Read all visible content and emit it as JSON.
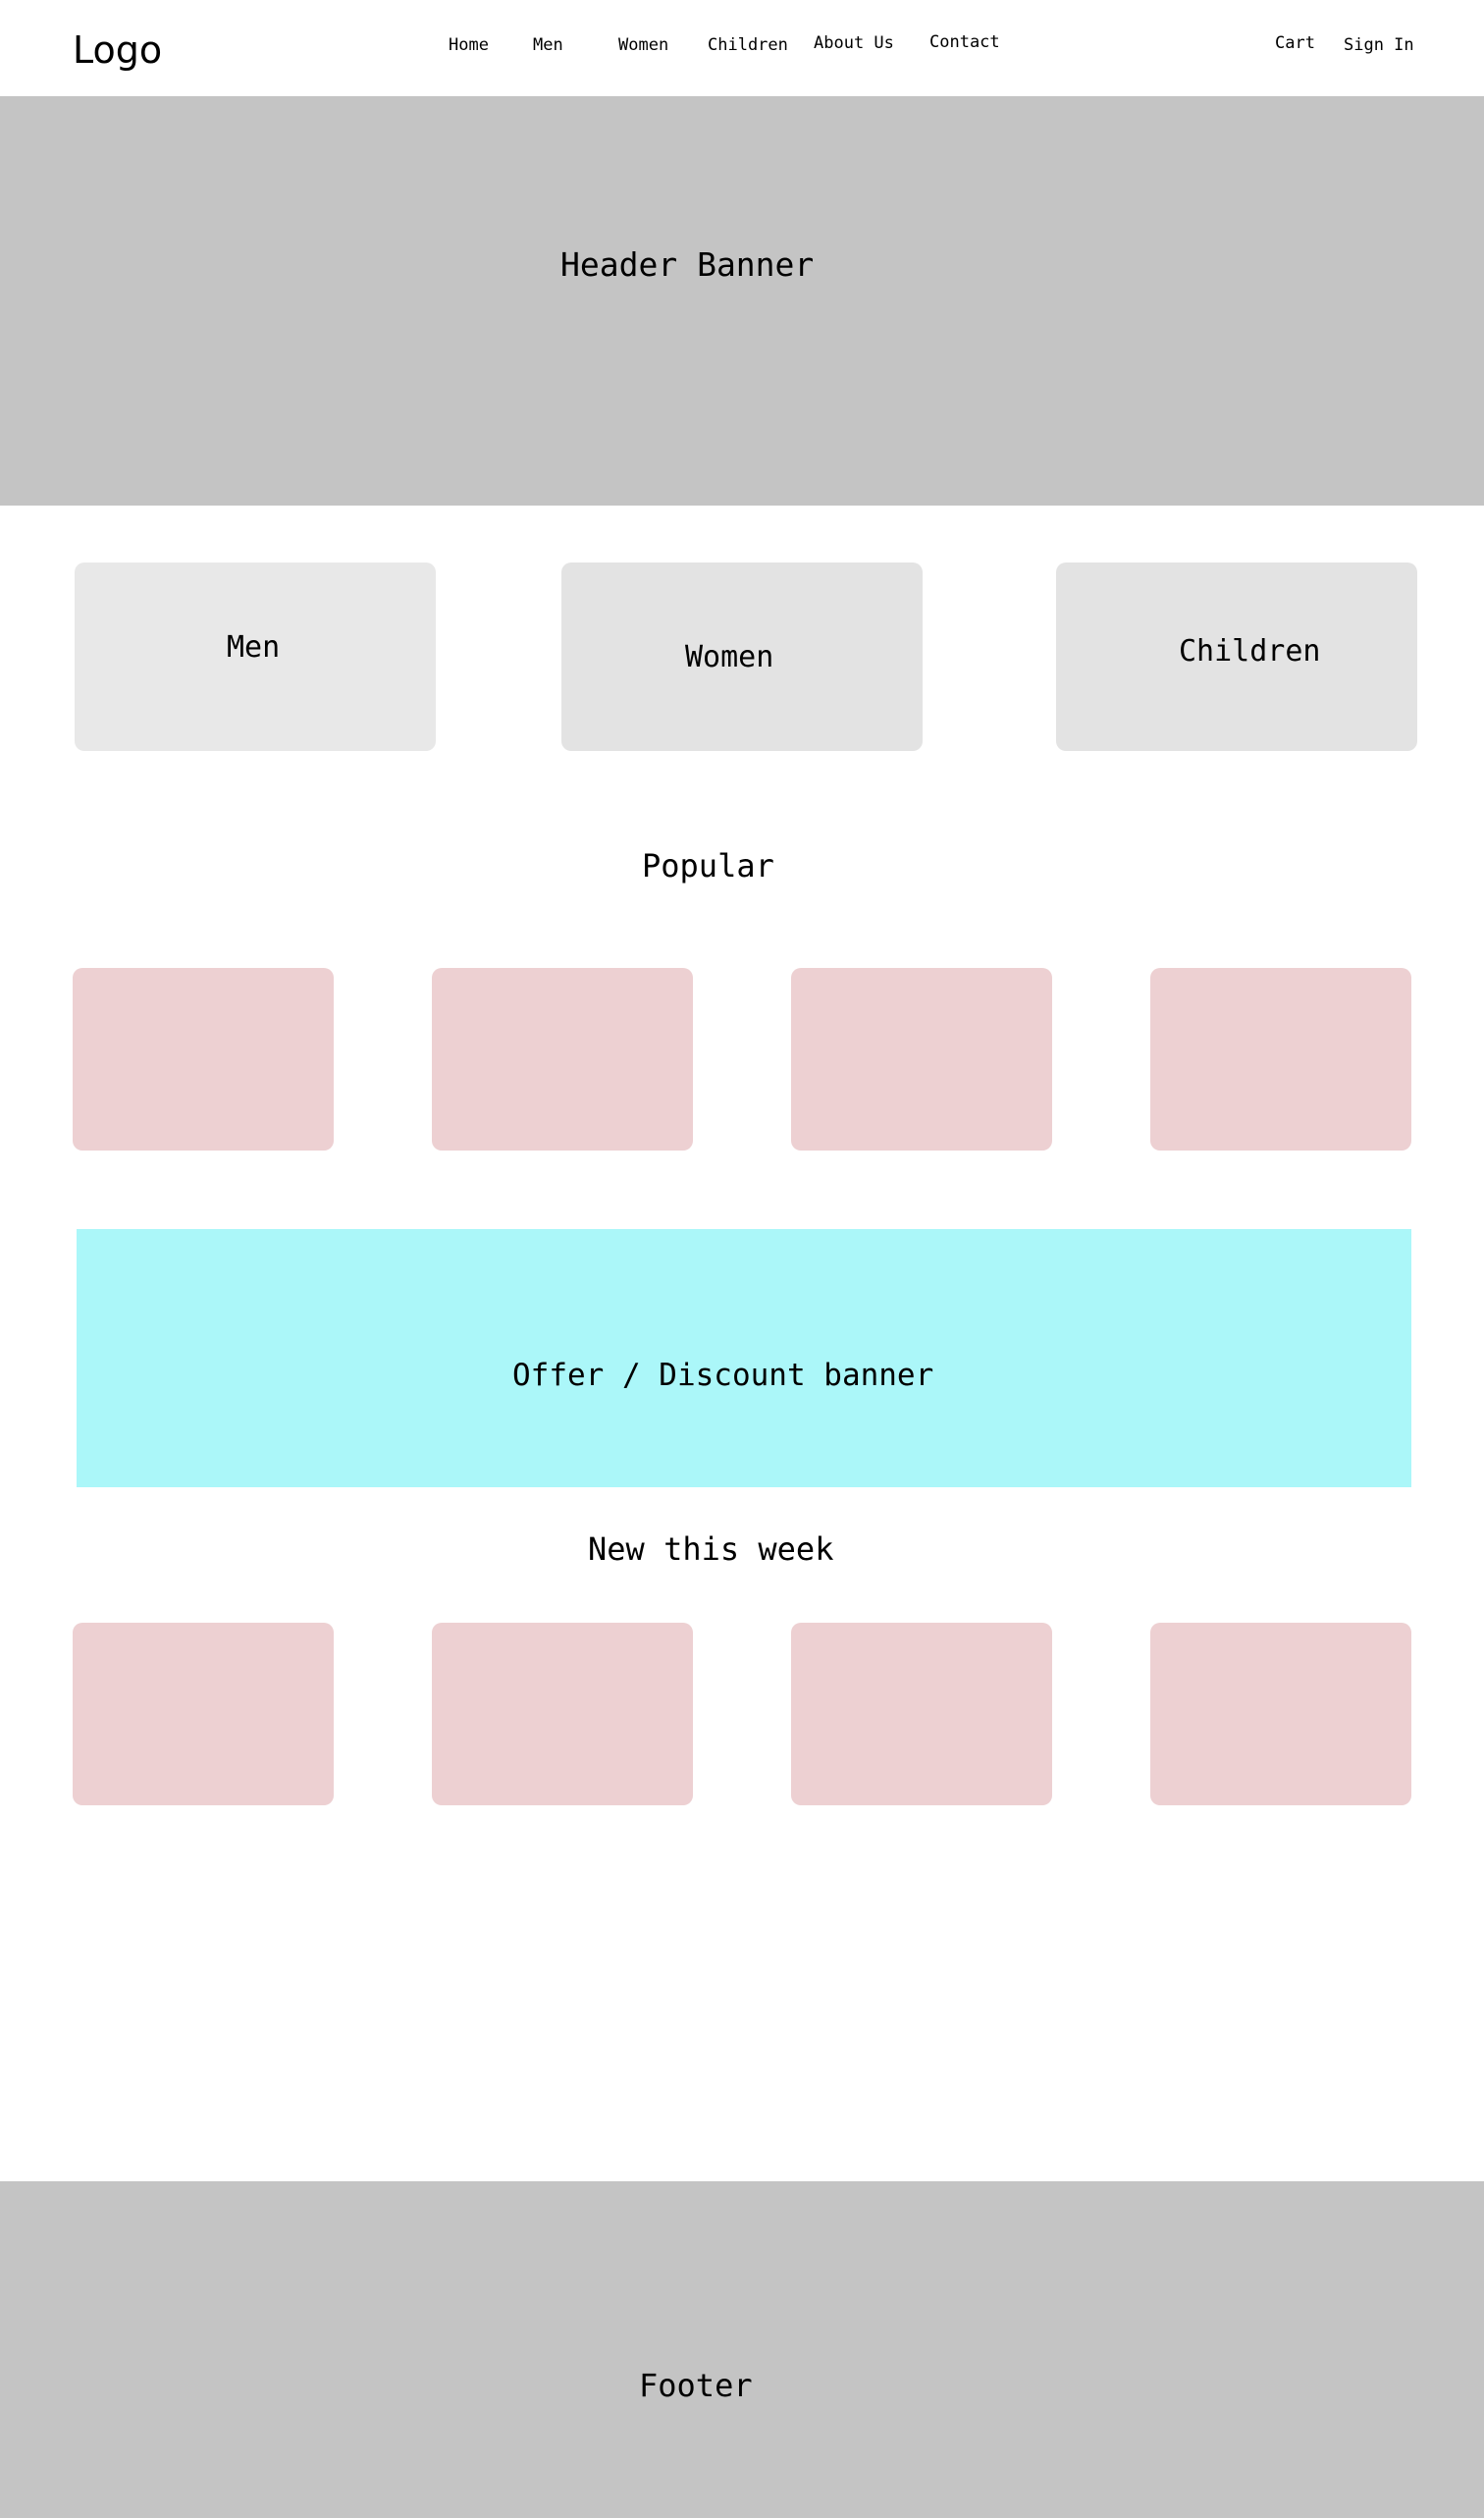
{
  "header": {
    "logo": "Logo",
    "nav": [
      "Home",
      "Men",
      "Women",
      "Children",
      "About Us",
      "Contact"
    ],
    "cart": "Cart",
    "sign_in": "Sign In"
  },
  "banner": {
    "title": "Header Banner"
  },
  "categories": [
    "Men",
    "Women",
    "Children"
  ],
  "popular": {
    "title": "Popular"
  },
  "offer": {
    "title": "Offer / Discount banner"
  },
  "new_this_week": {
    "title": "New this week"
  },
  "footer": {
    "title": "Footer"
  },
  "colors": {
    "banner_gray": "#c4c4c4",
    "category_card": "#e5e5e5",
    "product_placeholder": "#edd0d2",
    "offer_banner": "#abf7f9"
  }
}
